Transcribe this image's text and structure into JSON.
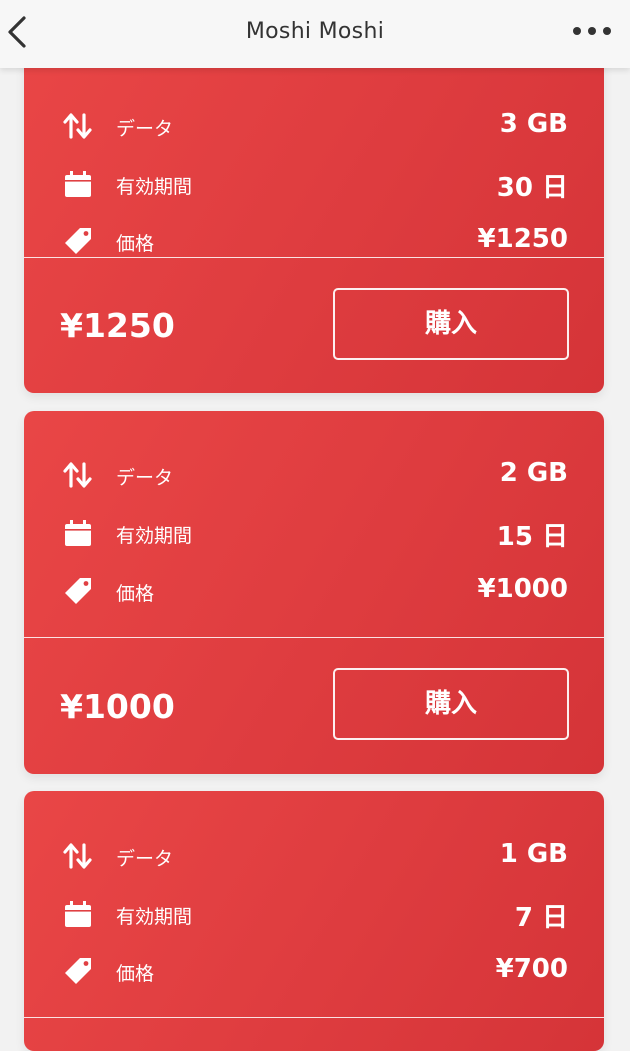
{
  "navbar": {
    "title": "Moshi Moshi",
    "back_icon": "chevron-left-icon",
    "more_icon": "ellipsis-icon"
  },
  "colors": {
    "card_red": "#e04043",
    "navbar_bg": "#f7f7f7",
    "page_bg": "#f2f2f2"
  },
  "labels": {
    "data": "データ",
    "validity": "有効期間",
    "price": "価格",
    "buy": "購入"
  },
  "plans": [
    {
      "data": "3 GB",
      "validity": "30 日",
      "price": "¥1250",
      "footer_price": "¥1250"
    },
    {
      "data": "2 GB",
      "validity": "15 日",
      "price": "¥1000",
      "footer_price": "¥1000"
    },
    {
      "data": "1 GB",
      "validity": "7 日",
      "price": "¥700"
    }
  ]
}
